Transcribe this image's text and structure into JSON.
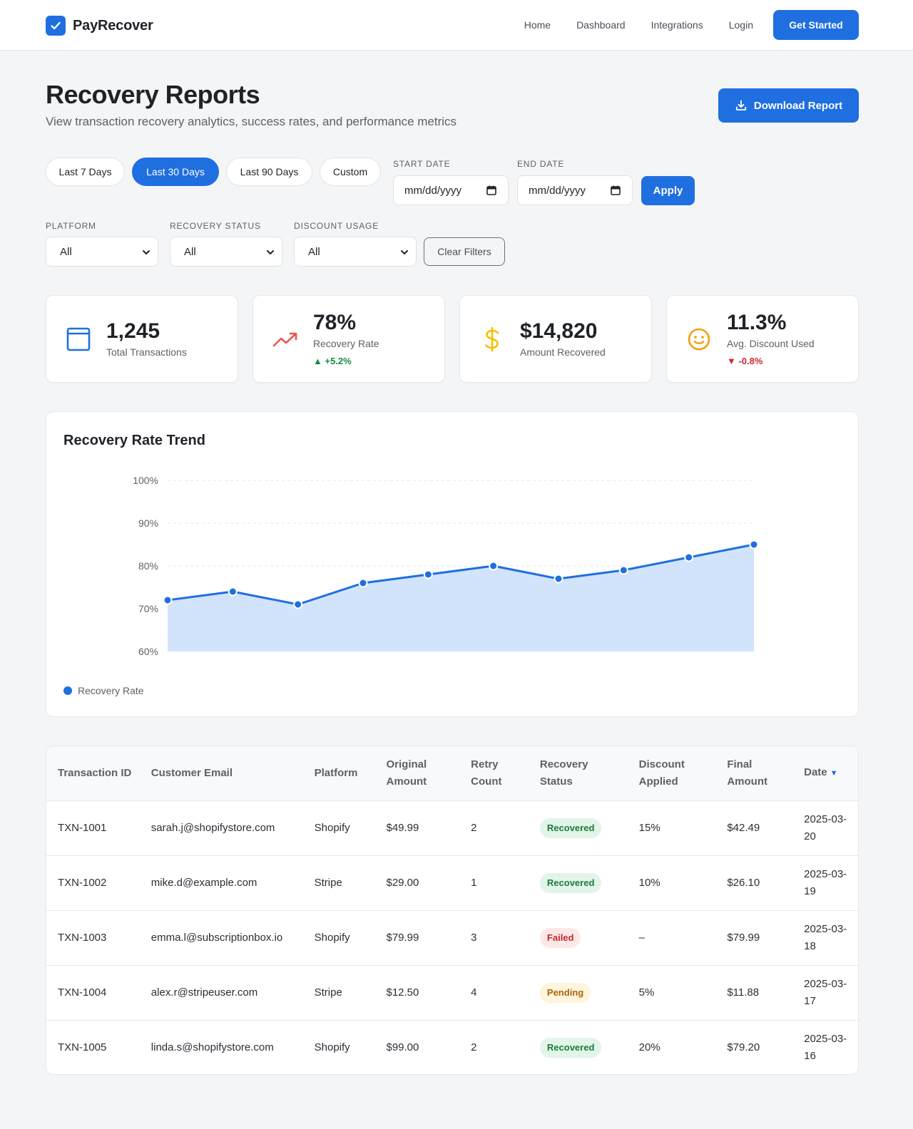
{
  "brand": {
    "name": "PayRecover",
    "logo_icon": "check-icon"
  },
  "nav": {
    "links": [
      "Home",
      "Dashboard",
      "Integrations",
      "Login"
    ],
    "cta": "Get Started"
  },
  "page": {
    "title": "Recovery Reports",
    "subtitle": "View transaction recovery analytics, success rates, and performance metrics",
    "download_label": "Download Report",
    "download_icon": "download-icon"
  },
  "filters": {
    "ranges": [
      "Last 7 Days",
      "Last 30 Days",
      "Last 90 Days",
      "Custom"
    ],
    "active_range": "Last 30 Days",
    "start_label": "Start Date",
    "end_label": "End Date",
    "date_placeholder": "mm/dd/yyyy",
    "apply_label": "Apply",
    "platform_label": "Platform",
    "platform_value": "All",
    "status_label": "Recovery Status",
    "status_value": "All",
    "discount_label": "Discount Usage",
    "discount_value": "All",
    "clear_label": "Clear Filters"
  },
  "kpis": [
    {
      "value": "1,245",
      "label": "Total Transactions",
      "icon": "window-icon",
      "color": "#1f6fe0"
    },
    {
      "value": "78%",
      "label": "Recovery Rate",
      "trend": "▲ +5.2%",
      "icon": "trending-up-icon",
      "color": "#ef5350"
    },
    {
      "value": "$14,820",
      "label": "Amount Recovered",
      "icon": "dollar-icon",
      "color": "#f5c000"
    },
    {
      "value": "11.3%",
      "label": "Avg. Discount Used",
      "trend": "▼ -0.8%",
      "icon": "smile-icon",
      "color": "#f59e0b"
    }
  ],
  "chart_data": {
    "type": "area",
    "title": "Recovery Rate Trend",
    "yticks": [
      "100%",
      "90%",
      "80%",
      "70%",
      "60%"
    ],
    "ylim": [
      60,
      100
    ],
    "grid": true,
    "legend_position": "bottom-left",
    "series": [
      {
        "name": "Recovery Rate",
        "color": "#1f6fe0",
        "fill": "#d2e3fc",
        "values": [
          72,
          74,
          71,
          76,
          78,
          80,
          77,
          79,
          82,
          85
        ]
      }
    ]
  },
  "table": {
    "headers": [
      "Transaction ID",
      "Customer Email",
      "Platform",
      "Original Amount",
      "Retry Count",
      "Recovery Status",
      "Discount Applied",
      "Final Amount",
      "Date"
    ],
    "sort_indicator": "▼",
    "rows": [
      [
        "TXN-1001",
        "sarah.j@shopifystore.com",
        "Shopify",
        "$49.99",
        "2",
        "Recovered",
        "15%",
        "$42.49",
        "2025-03-20"
      ],
      [
        "TXN-1002",
        "mike.d@example.com",
        "Stripe",
        "$29.00",
        "1",
        "Recovered",
        "10%",
        "$26.10",
        "2025-03-19"
      ],
      [
        "TXN-1003",
        "emma.l@subscriptionbox.io",
        "Shopify",
        "$79.99",
        "3",
        "Failed",
        "–",
        "$79.99",
        "2025-03-18"
      ],
      [
        "TXN-1004",
        "alex.r@stripeuser.com",
        "Stripe",
        "$12.50",
        "4",
        "Pending",
        "5%",
        "$11.88",
        "2025-03-17"
      ],
      [
        "TXN-1005",
        "linda.s@shopifystore.com",
        "Shopify",
        "$99.00",
        "2",
        "Recovered",
        "20%",
        "$79.20",
        "2025-03-16"
      ]
    ]
  }
}
